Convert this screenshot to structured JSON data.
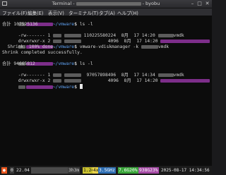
{
  "window": {
    "title_left": "Terminal -",
    "title_right": "- byobu",
    "minimize_icon": "minimize-icon",
    "maximize_icon": "maximize-icon",
    "close_icon": "close-icon"
  },
  "menubar": {
    "items": [
      "ファイル(F)",
      "編集(E)",
      "表示(V)",
      "ターミナル(T)",
      "タブ(A)",
      "ヘルプ(H)"
    ]
  },
  "terminal": {
    "prompt_tilde_dir": "~/vmware",
    "prompt_tilde": "~",
    "lines": {
      "cmd1": "ls -l",
      "total1": "合計 107525136",
      "file1_perms": "-rw------- 1",
      "file1_size": "110225580224",
      "file1_date": "8月  17 14:20",
      "file1_ext": "vmdk",
      "dir1_perms": "drwxrwxr-x 2",
      "dir1_size": "4096",
      "dir1_date": "8月  17 14:20",
      "cmd2": "vmware-vdiskmanager -k",
      "cmd2_ext": "vmdk",
      "shrink": "  Shrink: 100% done.",
      "shrink_done": "Shrink completed successfully.",
      "cmd3": "ls -l",
      "total2": "合計 94665812",
      "file2_perms": "-rw------- 1",
      "file2_size": "97057898496",
      "file2_date": "8月  17 14:34",
      "file2_ext": "vmdk",
      "dir2_perms": "drwxrwxr-x 2",
      "dir2_size": "4096",
      "dir2_date": "8月  17 14:20"
    }
  },
  "statusbar": {
    "window_num": "0",
    "segments": [
      "22.04",
      "3h3m",
      "1.24",
      "4x",
      "3.5GHz",
      "7.6G20%",
      "938G23%",
      "2025-08-17 14:34:56"
    ]
  },
  "colors": {
    "terminal_bg": "#0c0c0c",
    "prompt_green": "#5fd75f",
    "directory_blue": "#5fa0f0",
    "ubuntu_orange": "#e9561e",
    "redaction_purple": "#7d2e8a"
  }
}
